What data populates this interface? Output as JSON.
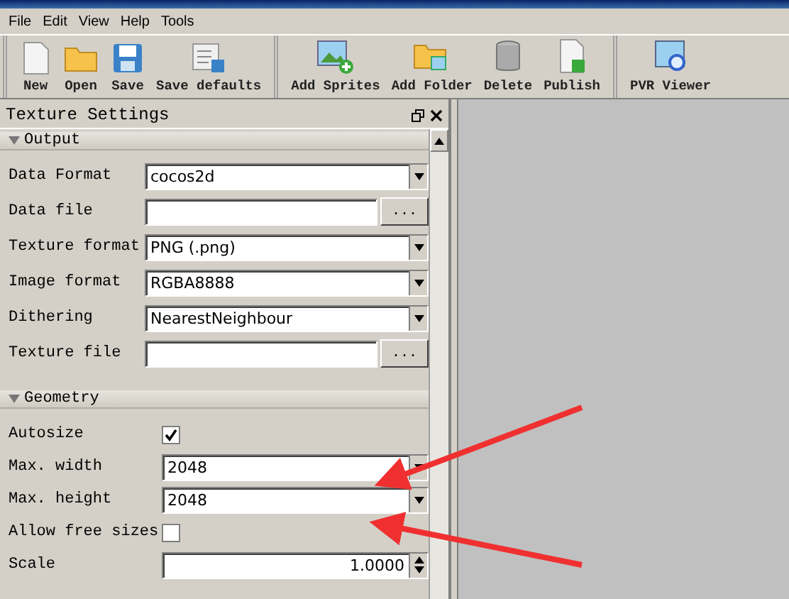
{
  "menu": [
    "File",
    "Edit",
    "View",
    "Help",
    "Tools"
  ],
  "toolbar": [
    [
      "New",
      "Open",
      "Save",
      "Save defaults"
    ],
    [
      "Add Sprites",
      "Add Folder",
      "Delete",
      "Publish"
    ],
    [
      "PVR Viewer"
    ]
  ],
  "panel": {
    "title": "Texture Settings",
    "sections": [
      {
        "title": "Output",
        "expanded": true,
        "rows": [
          {
            "kind": "combo",
            "label": "Data Format",
            "value": "cocos2d"
          },
          {
            "kind": "file",
            "label": "Data file",
            "button": "..."
          },
          {
            "kind": "combo",
            "label": "Texture format",
            "value": "PNG (.png)"
          },
          {
            "kind": "combo",
            "label": "Image format",
            "value": "RGBA8888"
          },
          {
            "kind": "combo",
            "label": "Dithering",
            "value": "NearestNeighbour"
          },
          {
            "kind": "file",
            "label": "Texture file",
            "button": "..."
          }
        ]
      },
      {
        "title": "Geometry",
        "expanded": true,
        "rows": [
          {
            "kind": "checkbox",
            "label": "Autosize",
            "checked": true
          },
          {
            "kind": "combo",
            "label": "Max. width",
            "value": "2048"
          },
          {
            "kind": "combo",
            "label": "Max. height",
            "value": "2048"
          },
          {
            "kind": "checkbox",
            "label": "Allow free sizes",
            "checked": false
          },
          {
            "kind": "spin",
            "label": "Scale",
            "value": "1.0000"
          }
        ]
      }
    ]
  }
}
